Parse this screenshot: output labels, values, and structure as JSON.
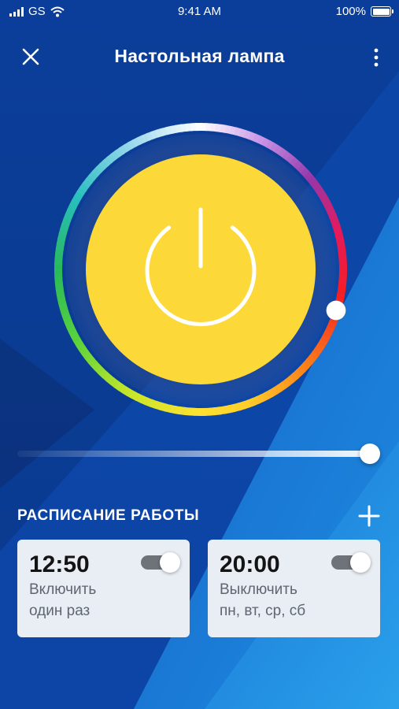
{
  "status_bar": {
    "carrier": "GS",
    "time": "9:41 AM",
    "battery": "100%"
  },
  "header": {
    "title": "Настольная лампа",
    "close_icon": "close-icon",
    "menu_icon": "more-vertical-icon"
  },
  "lamp": {
    "power_icon": "power-icon",
    "lamp_color": "#fcd838",
    "hue_handle": "hue-slider-handle"
  },
  "brightness": {
    "value_percent": 100
  },
  "schedule": {
    "title": "РАСПИСАНИЕ РАБОТЫ",
    "add_icon": "plus-icon",
    "items": [
      {
        "time": "12:50",
        "action": "Включить",
        "repeat": "один раз",
        "enabled": true
      },
      {
        "time": "20:00",
        "action": "Выключить",
        "repeat": "пн, вт, ср, сб",
        "enabled": true
      }
    ]
  },
  "colors": {
    "background": "#0a3f98",
    "accent_yellow": "#fcd838",
    "card_bg": "#e9eef5",
    "toggle_track": "#6e7379"
  }
}
